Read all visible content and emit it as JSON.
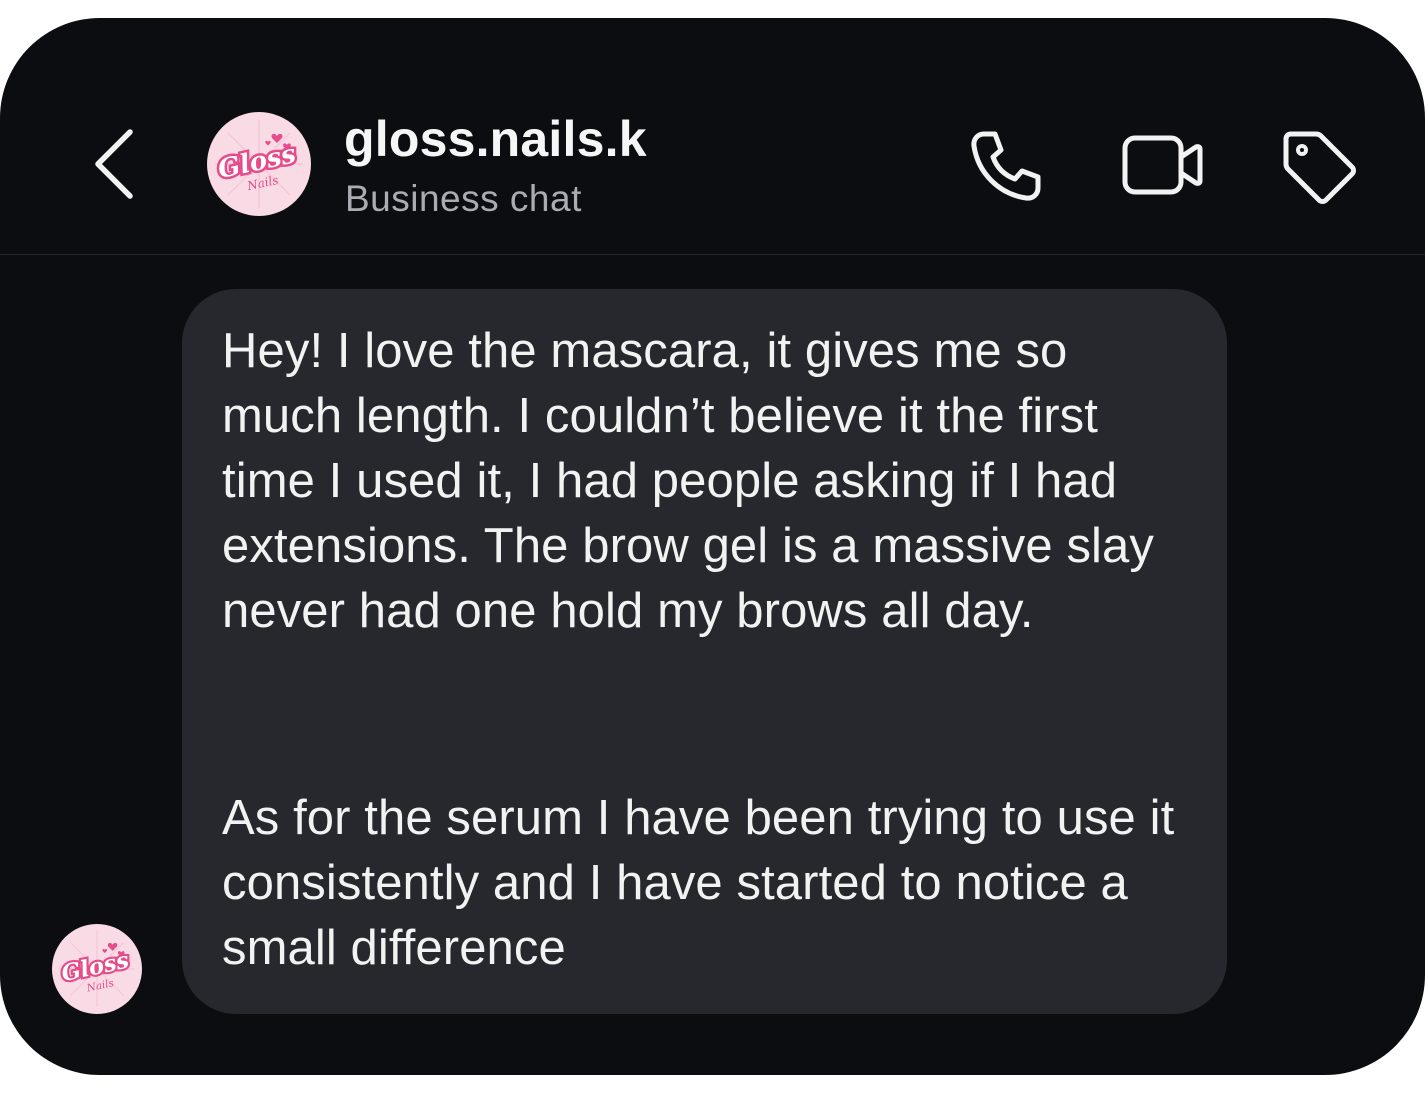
{
  "header": {
    "title": "gloss.nails.k",
    "subtitle": "Business chat",
    "back_icon": "chevron-left-icon",
    "actions": [
      {
        "name": "phone-icon"
      },
      {
        "name": "video-camera-icon"
      },
      {
        "name": "tag-icon"
      }
    ]
  },
  "avatar": {
    "logo_text": "Gloss",
    "logo_subtext": "Nails",
    "bg_color": "#f9dbe6",
    "accent_color": "#e64b8a"
  },
  "message": {
    "paragraphs": [
      "Hey! I love the mascara, it gives me so much length. I couldn’t believe it the first time I used it, I had people asking if I had extensions. The brow gel is a massive slay never had one hold my brows all day.",
      "As for the serum I have been trying to use it consistently and I have started to notice a small difference"
    ]
  },
  "colors": {
    "background": "#0c0d10",
    "bubble": "#26282d",
    "text": "#f2f2f2",
    "subtitle": "#a9acb3"
  }
}
